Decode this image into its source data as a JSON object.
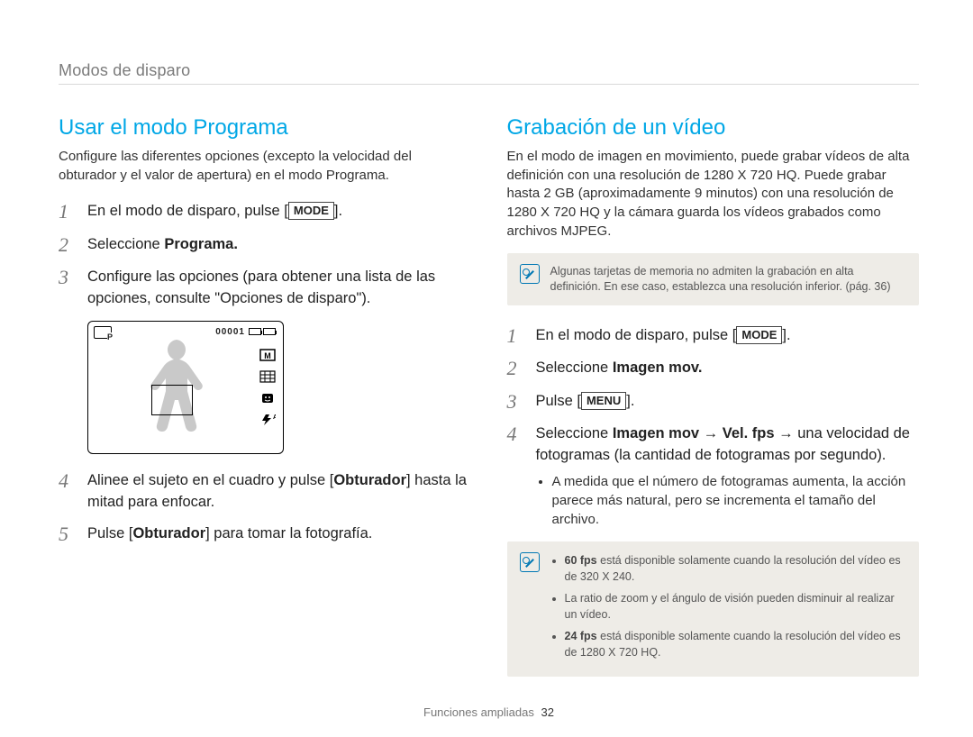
{
  "breadcrumb": "Modos de disparo",
  "left": {
    "heading": "Usar el modo Programa",
    "intro": "Configure las diferentes opciones (excepto la velocidad del obturador y el valor de apertura) en el modo Programa.",
    "steps": {
      "s1_a": "En el modo de disparo, pulse [",
      "s1_btn": "MODE",
      "s1_b": "].",
      "s2_a": "Seleccione ",
      "s2_bold": "Programa.",
      "s3": "Configure las opciones (para obtener una lista de las opciones, consulte \"Opciones de disparo\").",
      "s4_a": "Alinee el sujeto en el cuadro y pulse [",
      "s4_bold": "Obturador",
      "s4_b": "] hasta la mitad para enfocar.",
      "s5_a": "Pulse [",
      "s5_bold": "Obturador",
      "s5_b": "] para tomar la fotografía."
    },
    "camera": {
      "counter": "00001",
      "side_labels": {
        "m": "M",
        "flash_a": "A"
      }
    }
  },
  "right": {
    "heading": "Grabación de un vídeo",
    "intro": "En el modo de imagen en movimiento, puede grabar vídeos de alta definición con una resolución de 1280 X 720 HQ. Puede grabar hasta 2 GB (aproximadamente 9 minutos) con una resolución de 1280 X 720 HQ y la cámara guarda los vídeos grabados como archivos MJPEG.",
    "note1": "Algunas tarjetas de memoria no admiten la grabación en alta definición. En ese caso, establezca una resolución inferior. (pág. 36)",
    "steps": {
      "s1_a": "En el modo de disparo, pulse [",
      "s1_btn": "MODE",
      "s1_b": "].",
      "s2_a": "Seleccione ",
      "s2_bold": "Imagen mov.",
      "s3_a": "Pulse [",
      "s3_btn": "MENU",
      "s3_b": "].",
      "s4_a": "Seleccione ",
      "s4_b1": "Imagen mov",
      "s4_arrow1": " → ",
      "s4_b2": "Vel. fps",
      "s4_arrow2": " → una velocidad de fotogramas (la cantidad de fotogramas por segundo).",
      "s4_sub": "A medida que el número de fotogramas aumenta, la acción parece más natural, pero se incrementa el tamaño del archivo."
    },
    "note2": {
      "b1_bold": "60 fps",
      "b1": " está disponible solamente cuando la resolución del vídeo es de 320 X 240.",
      "b2": "La ratio de zoom y el ángulo de visión pueden disminuir al realizar un vídeo.",
      "b3_bold": "24 fps",
      "b3": " está disponible solamente cuando la resolución del vídeo es de 1280 X 720 HQ."
    }
  },
  "footer": {
    "section": "Funciones ampliadas",
    "page": "32"
  }
}
